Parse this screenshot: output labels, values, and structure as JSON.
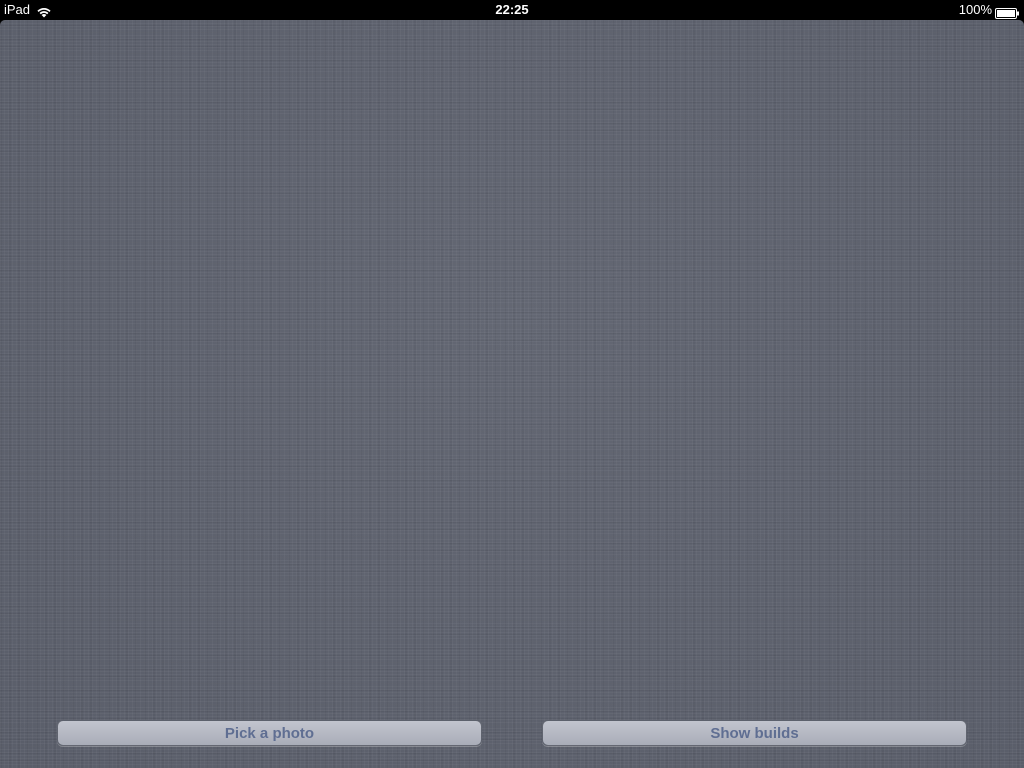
{
  "status_bar": {
    "device": "iPad",
    "wifi_icon": "wifi-icon",
    "time": "22:25",
    "battery": "100%",
    "battery_icon": "battery-icon"
  },
  "buttons": {
    "pick_photo": "Pick a photo",
    "show_builds": "Show builds"
  },
  "colors": {
    "background": "#5c606c",
    "button_fill": "#b3b6c0",
    "button_text": "#5f6e92",
    "status_bar": "#000000"
  }
}
